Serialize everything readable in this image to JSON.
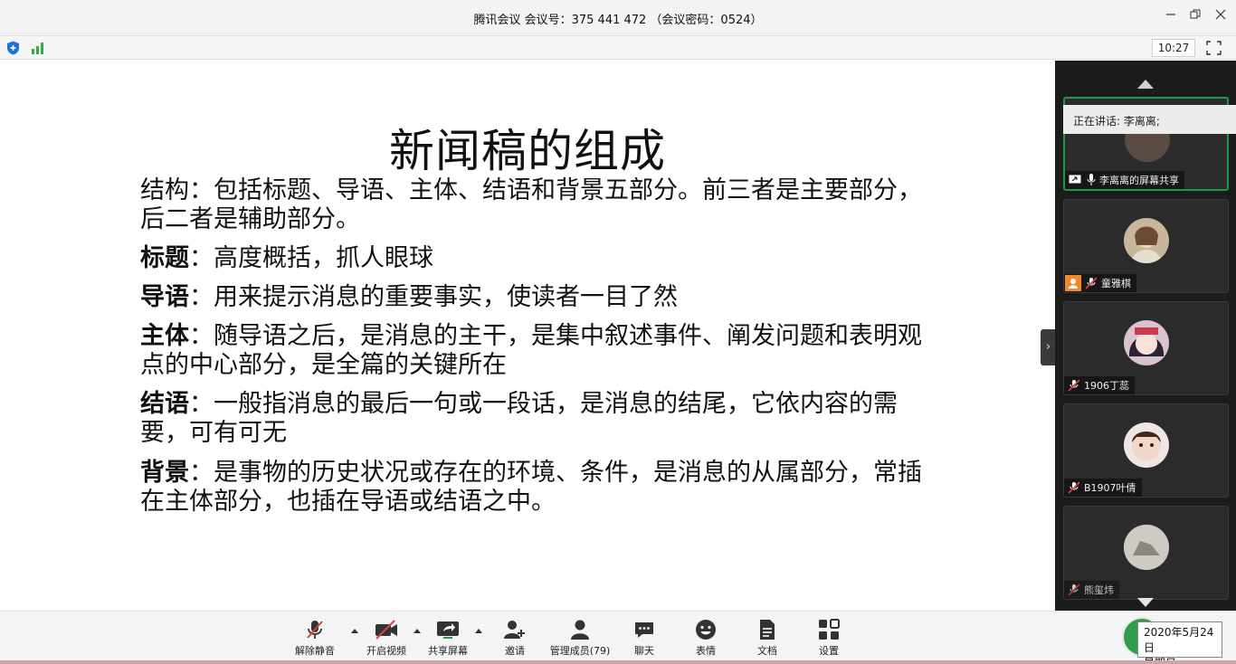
{
  "window": {
    "title": "腾讯会议 会议号：375 441 472 （会议密码：0524）"
  },
  "toolbar": {
    "time": "10:27"
  },
  "slide": {
    "title": "新闻稿的组成",
    "paragraphs": [
      {
        "label": "",
        "text": "结构：包括标题、导语、主体、结语和背景五部分。前三者是主要部分，后二者是辅助部分。"
      },
      {
        "label": "标题",
        "text": "：高度概括，抓人眼球"
      },
      {
        "label": "导语",
        "text": "：用来提示消息的重要事实，使读者一目了然"
      },
      {
        "label": "主体",
        "text": "：随导语之后，是消息的主干，是集中叙述事件、阐发问题和表明观点的中心部分，是全篇的关键所在"
      },
      {
        "label": "结语",
        "text": "：一般指消息的最后一句或一段话，是消息的结尾，它依内容的需要，可有可无"
      },
      {
        "label": "背景",
        "text": "：是事物的历史状况或存在的环境、条件，是消息的从属部分，常插在主体部分，也插在导语或结语之中。"
      }
    ]
  },
  "speaking": {
    "text": "正在讲话: 李离离;"
  },
  "participants": [
    {
      "name": "李离离的屏幕共享",
      "state": "sharing"
    },
    {
      "name": "童雅棋",
      "state": "muted"
    },
    {
      "name": "1906丁蕊",
      "state": "muted"
    },
    {
      "name": "B1907叶倩",
      "state": "muted"
    },
    {
      "name": "熊玺炜",
      "state": "muted"
    }
  ],
  "controls": {
    "unmute": "解除静音",
    "start_video": "开启视频",
    "share_screen": "共享屏幕",
    "invite": "邀请",
    "manage_members": "管理成员(79)",
    "chat": "聊天",
    "reactions": "表情",
    "docs": "文档",
    "settings": "设置"
  },
  "date_tooltip": {
    "date": "2020年5月24日",
    "weekday": "星期日"
  },
  "colors": {
    "accent_green": "#1e9a45",
    "panel_bg": "#1c1c1c",
    "mute_red": "#e0403a"
  }
}
